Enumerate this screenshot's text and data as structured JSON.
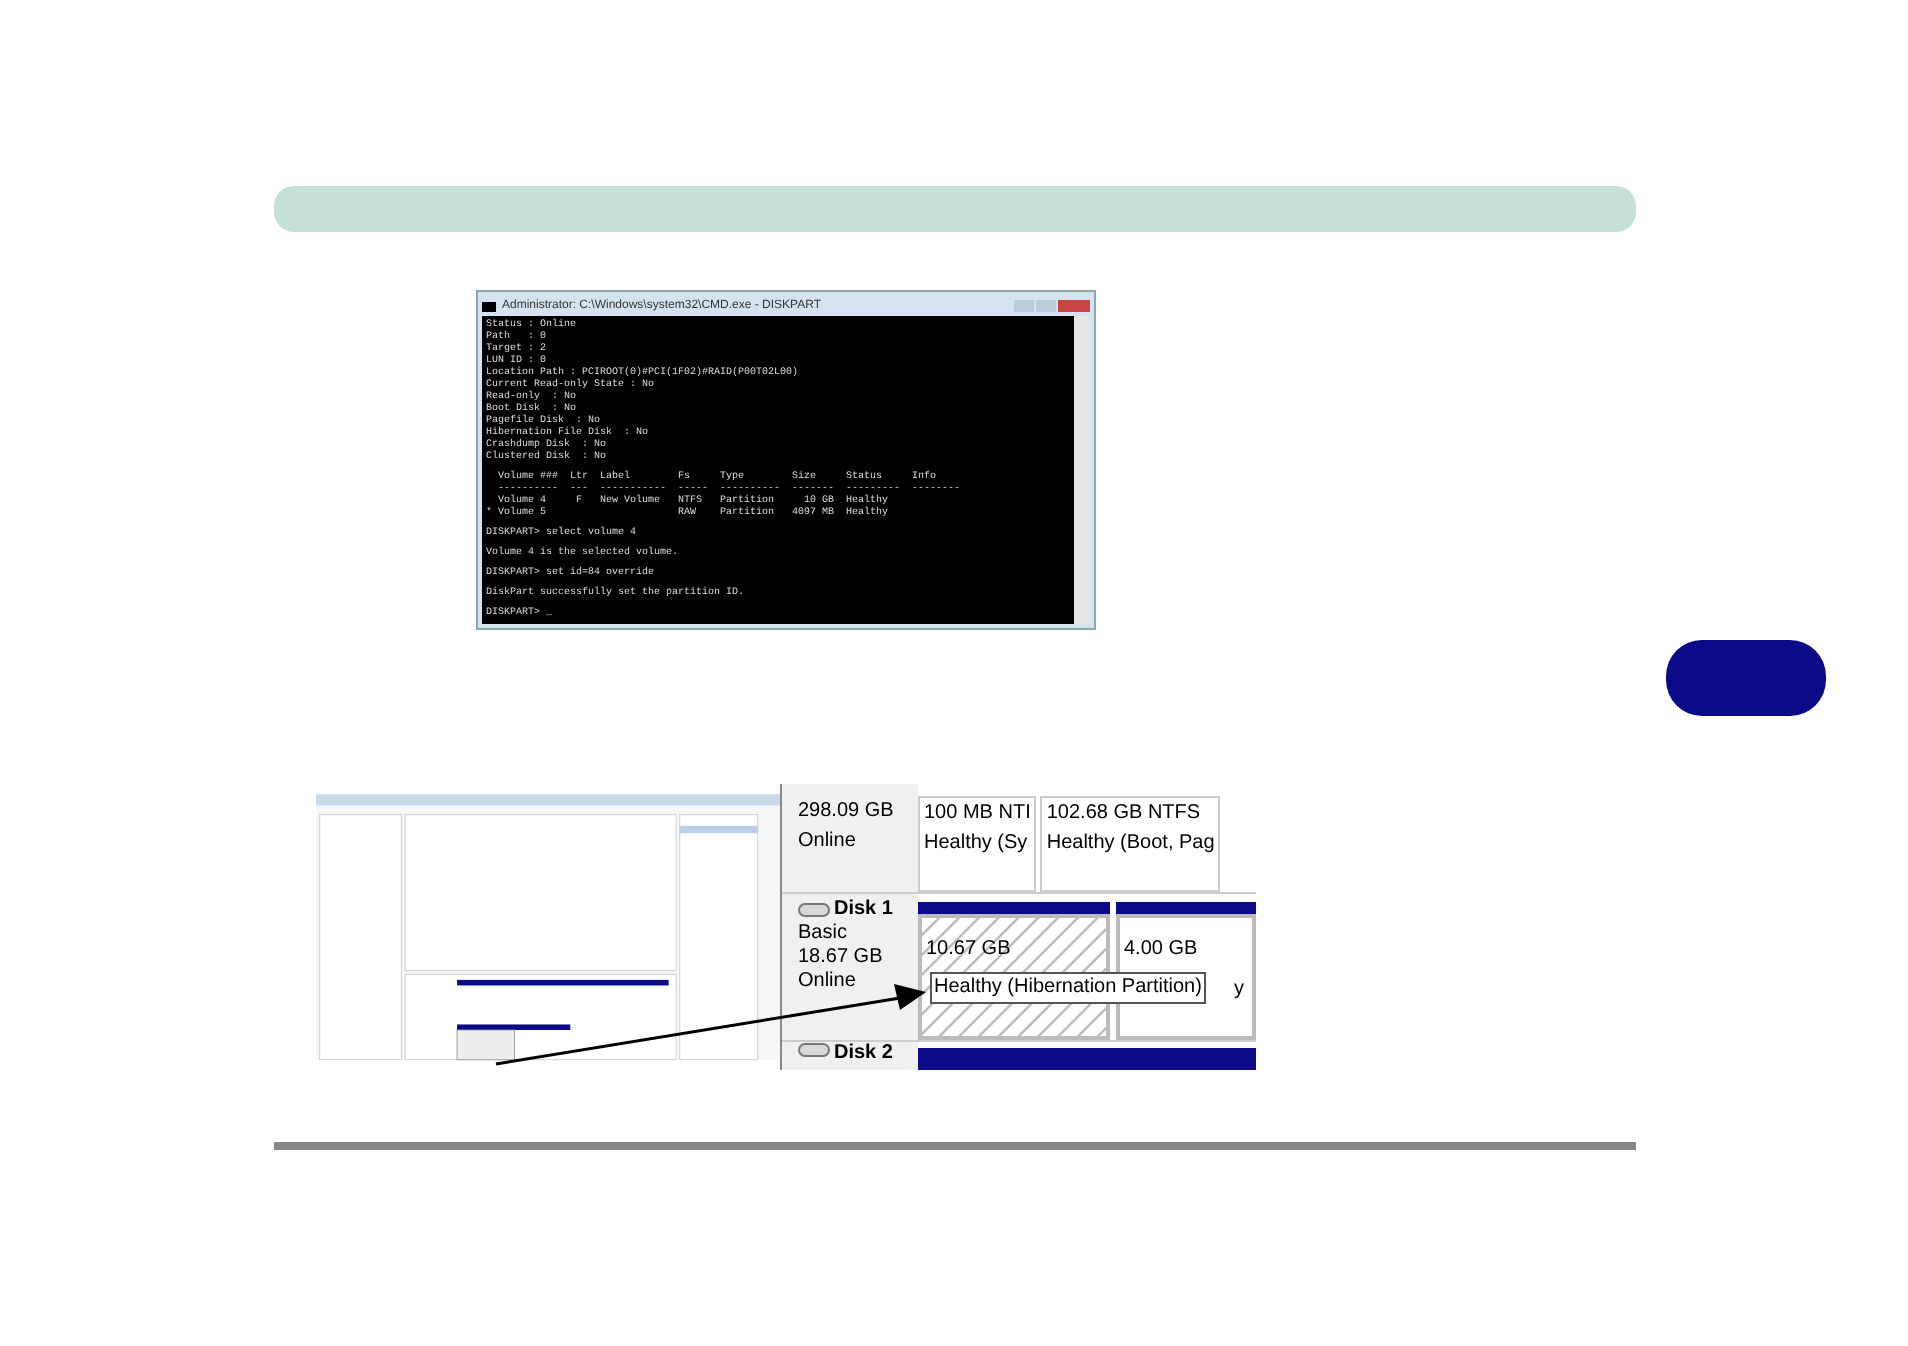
{
  "console_window": {
    "title": "Administrator: C:\\Windows\\system32\\CMD.exe - DISKPART",
    "blocks": [
      {
        "lines": [
          "Status : Online",
          "Path   : 0",
          "Target : 2",
          "LUN ID : 0",
          "Location Path : PCIROOT(0)#PCI(1F02)#RAID(P00T02L00)",
          "Current Read-only State : No",
          "Read-only  : No",
          "Boot Disk  : No",
          "Pagefile Disk  : No",
          "Hibernation File Disk  : No",
          "Crashdump Disk  : No",
          "Clustered Disk  : No"
        ]
      },
      {
        "lines": [
          "  Volume ###  Ltr  Label        Fs     Type        Size     Status     Info",
          "  ----------  ---  -----------  -----  ----------  -------  ---------  --------",
          "  Volume 4     F   New Volume   NTFS   Partition     10 GB  Healthy",
          "* Volume 5                      RAW    Partition   4097 MB  Healthy"
        ]
      },
      {
        "lines": [
          "DISKPART> select volume 4"
        ]
      },
      {
        "lines": [
          "Volume 4 is the selected volume."
        ]
      },
      {
        "lines": [
          "DISKPART> set id=84 override"
        ]
      },
      {
        "lines": [
          "DiskPart successfully set the partition ID."
        ]
      },
      {
        "lines": [
          "DISKPART> _"
        ]
      }
    ]
  },
  "disk_zoom": {
    "disk_0": {
      "size": "298.09 GB",
      "status": "Online",
      "partitions": [
        {
          "size": "100 MB NTI",
          "health": "Healthy (Sy"
        },
        {
          "size": "102.68 GB NTFS",
          "health": "Healthy (Boot, Pag"
        }
      ]
    },
    "disk_1": {
      "name": "Disk 1",
      "type": "Basic",
      "size": "18.67 GB",
      "status": "Online",
      "partitions": [
        {
          "size": "10.67 GB",
          "hatched": true
        },
        {
          "size": "4.00 GB",
          "hatched": false
        }
      ],
      "tooltip": "Healthy (Hibernation Partition)",
      "tooltip_tail": "y"
    },
    "disk_2": {
      "name": "Disk 2"
    }
  }
}
